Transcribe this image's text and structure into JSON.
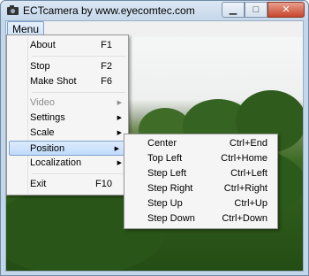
{
  "window": {
    "title": "ECTcamera by www.eyecomtec.com"
  },
  "menubar": {
    "menu_label": "Menu"
  },
  "menu": {
    "items": [
      {
        "label": "About",
        "shortcut": "F1"
      },
      {
        "label": "Stop",
        "shortcut": "F2"
      },
      {
        "label": "Make Shot",
        "shortcut": "F6"
      },
      {
        "label": "Video",
        "disabled": true,
        "submenu": true
      },
      {
        "label": "Settings",
        "submenu": true
      },
      {
        "label": "Scale",
        "submenu": true
      },
      {
        "label": "Position",
        "submenu": true,
        "highlighted": true
      },
      {
        "label": "Localization",
        "submenu": true
      },
      {
        "label": "Exit",
        "shortcut": "F10"
      }
    ]
  },
  "position_submenu": {
    "items": [
      {
        "label": "Center",
        "shortcut": "Ctrl+End"
      },
      {
        "label": "Top Left",
        "shortcut": "Ctrl+Home"
      },
      {
        "label": "Step Left",
        "shortcut": "Ctrl+Left"
      },
      {
        "label": "Step Right",
        "shortcut": "Ctrl+Right"
      },
      {
        "label": "Step Up",
        "shortcut": "Ctrl+Up"
      },
      {
        "label": "Step Down",
        "shortcut": "Ctrl+Down"
      }
    ]
  },
  "icons": {
    "app": "camera-icon",
    "submenu": "chevron-right-icon",
    "minimize": "minimize-icon",
    "maximize": "maximize-icon",
    "close": "close-icon"
  }
}
